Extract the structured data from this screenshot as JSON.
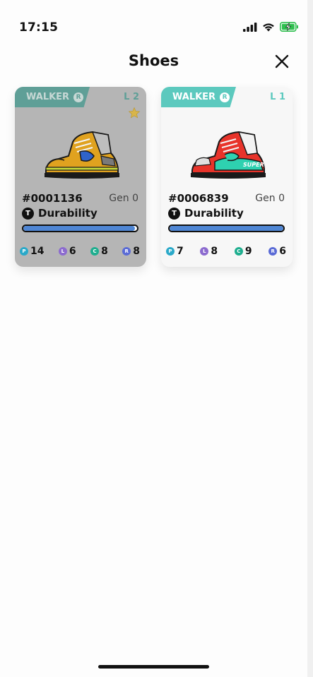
{
  "status_bar": {
    "time": "17:15",
    "icons": [
      "signal-icon",
      "wifi-icon",
      "battery-charging-icon"
    ]
  },
  "header": {
    "title": "Shoes",
    "close_icon": "close-icon"
  },
  "cards": [
    {
      "tag": "WALKER",
      "rarity": "R",
      "level": "L 2",
      "starred": true,
      "id": "#0001136",
      "gen": "Gen 0",
      "attribute_icon": "T",
      "attribute": "Durability",
      "durability_fraction": 0.98,
      "stats": [
        {
          "icon": "P",
          "value": "14"
        },
        {
          "icon": "L",
          "value": "6"
        },
        {
          "icon": "C",
          "value": "8"
        },
        {
          "icon": "R",
          "value": "8"
        }
      ],
      "colors": {
        "card": "#b5b5b5",
        "tag": "#5f9f97"
      }
    },
    {
      "tag": "WALKER",
      "rarity": "R",
      "level": "L 1",
      "starred": false,
      "id": "#0006839",
      "gen": "Gen 0",
      "attribute_icon": "T",
      "attribute": "Durability",
      "durability_fraction": 1.0,
      "stats": [
        {
          "icon": "P",
          "value": "7"
        },
        {
          "icon": "L",
          "value": "8"
        },
        {
          "icon": "C",
          "value": "9"
        },
        {
          "icon": "R",
          "value": "6"
        }
      ],
      "shoe_label": "SUPER",
      "colors": {
        "card": "#f7f7f7",
        "tag": "#5cc9be"
      }
    }
  ],
  "accent_bar_color": "#4f86d4"
}
